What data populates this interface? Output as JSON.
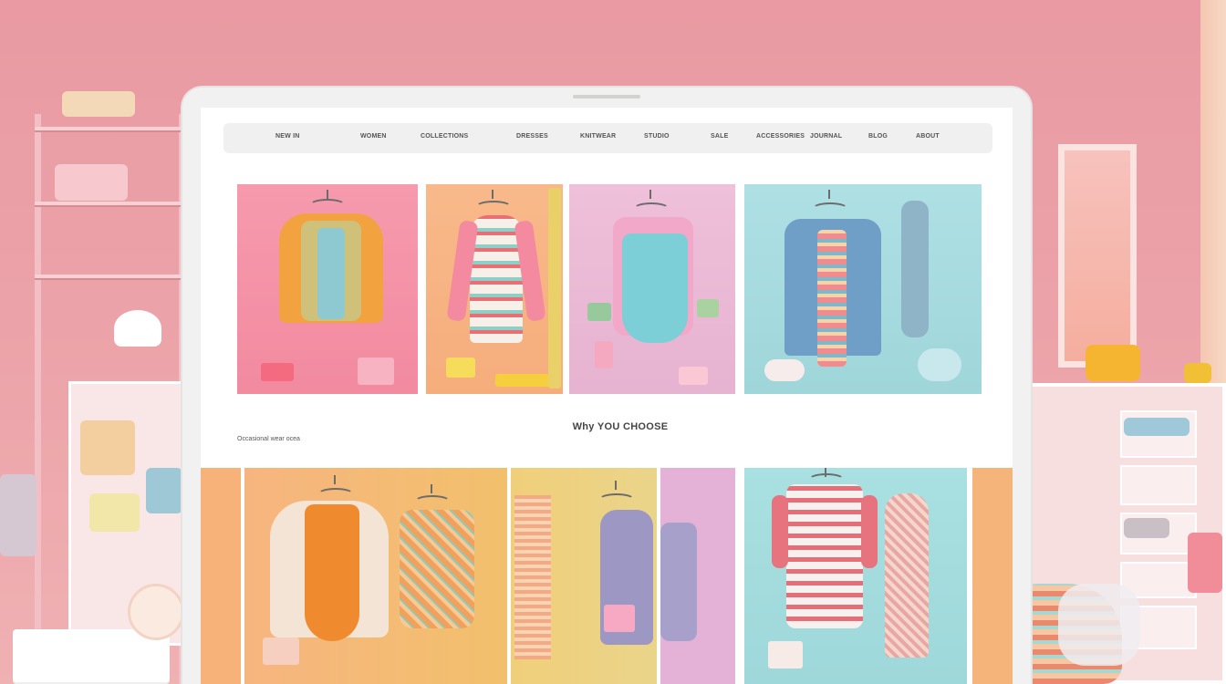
{
  "navigation": {
    "items": [
      "NEW IN",
      "WOMEN",
      "COLLECTIONS",
      "DRESSES",
      "KNITWEAR",
      "STUDIO",
      "SALE",
      "ACCESSORIES",
      "JOURNAL",
      "BLOG",
      "ABOUT"
    ]
  },
  "sections": {
    "heading": "Why YOU CHOOSE",
    "caption": "Occasional wear  ocea"
  },
  "products": {
    "row1": [
      {
        "name": "Orange embroidered vest set",
        "backdrop": "#f594a6"
      },
      {
        "name": "Floral print tunic",
        "backdrop": "#f7b488"
      },
      {
        "name": "Aqua pinafore dress",
        "backdrop": "#eab8d6"
      },
      {
        "name": "Blue knit cardigan set",
        "backdrop": "#a9dde0"
      }
    ],
    "row2": [
      {
        "name": "Orange bohemian tunic",
        "backdrop": "#f6b57f"
      },
      {
        "name": "Patterned knit top",
        "backdrop": "#f2c16c"
      },
      {
        "name": "Layered lilac dress",
        "backdrop": "#ebd38a"
      },
      {
        "name": "Striped knit dress",
        "backdrop": "#a6dfe0"
      }
    ]
  },
  "theme": {
    "wall": "#e99aa2",
    "monitor_frame": "#f2f1f1",
    "screen": "#ffffff",
    "navbar": "#f1f0f0"
  }
}
